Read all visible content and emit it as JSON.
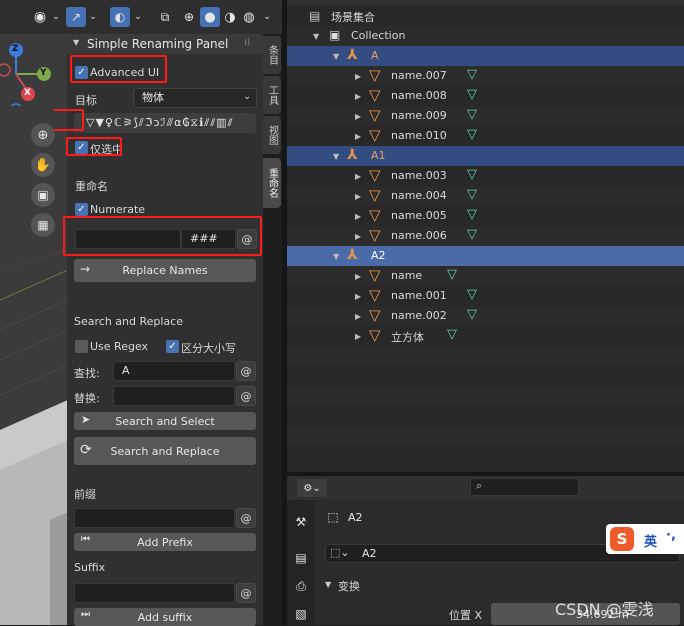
{
  "viewport": {
    "gizmo_axes": {
      "x": "X",
      "y": "Y",
      "z": "Z",
      "neg_x": "X"
    }
  },
  "panel": {
    "title": "Simple Renaming Panel",
    "advanced_ui_label": "Advanced UI",
    "target_label": "目标",
    "target_value": "物体",
    "selected_only_label": "仅选中",
    "rename_section": "重命名",
    "numerate_label": "Numerate",
    "name_placeholder": "",
    "numerate_pattern": "###",
    "replace_names_button": "Replace Names",
    "search_replace_section": "Search and Replace",
    "use_regex_label": "Use Regex",
    "case_sensitive_label": "区分大小写",
    "find_label": "查找:",
    "find_value": "A",
    "replace_label": "替换:",
    "replace_value": "",
    "search_select_button": "Search and Select",
    "search_replace_button": "Search and Replace",
    "prefix_section": "前缀",
    "add_prefix_button": "Add Prefix",
    "suffix_section": "Suffix",
    "add_suffix_button": "Add suffix",
    "at_symbol": "@"
  },
  "side_tabs": [
    "条目",
    "工具",
    "视图",
    "重命名"
  ],
  "outliner": {
    "scene_collection": "场景集合",
    "collection": "Collection",
    "objects": [
      {
        "name": "A",
        "level": 1,
        "type": "empty",
        "selected": true
      },
      {
        "name": "name.007",
        "level": 2,
        "type": "mesh"
      },
      {
        "name": "name.008",
        "level": 2,
        "type": "mesh"
      },
      {
        "name": "name.009",
        "level": 2,
        "type": "mesh"
      },
      {
        "name": "name.010",
        "level": 2,
        "type": "mesh"
      },
      {
        "name": "A1",
        "level": 1,
        "type": "empty",
        "selected": true
      },
      {
        "name": "name.003",
        "level": 2,
        "type": "mesh"
      },
      {
        "name": "name.004",
        "level": 2,
        "type": "mesh"
      },
      {
        "name": "name.005",
        "level": 2,
        "type": "mesh"
      },
      {
        "name": "name.006",
        "level": 2,
        "type": "mesh"
      },
      {
        "name": "A2",
        "level": 1,
        "type": "empty",
        "selected": true,
        "active": true
      },
      {
        "name": "name",
        "level": 2,
        "type": "mesh"
      },
      {
        "name": "name.001",
        "level": 2,
        "type": "mesh"
      },
      {
        "name": "name.002",
        "level": 2,
        "type": "mesh"
      },
      {
        "name": "立方体",
        "level": 2,
        "type": "mesh"
      }
    ]
  },
  "properties": {
    "search_placeholder": "",
    "object_name": "A2",
    "object_data_name": "A2",
    "transform_section": "变换",
    "location_x_label": "位置 X",
    "location_x_value": "34.692 m"
  },
  "ime_badge": {
    "text": "英",
    "extra": "·,"
  },
  "watermark": "CSDN @雯浅",
  "colors": {
    "accent_blue": "#4772b3",
    "selected_row": "#334d80",
    "active_row": "#4a6aa8",
    "empty_orange": "#e8954a",
    "mesh_green": "#5fd3a1",
    "red_highlight": "#ff1a1a"
  }
}
